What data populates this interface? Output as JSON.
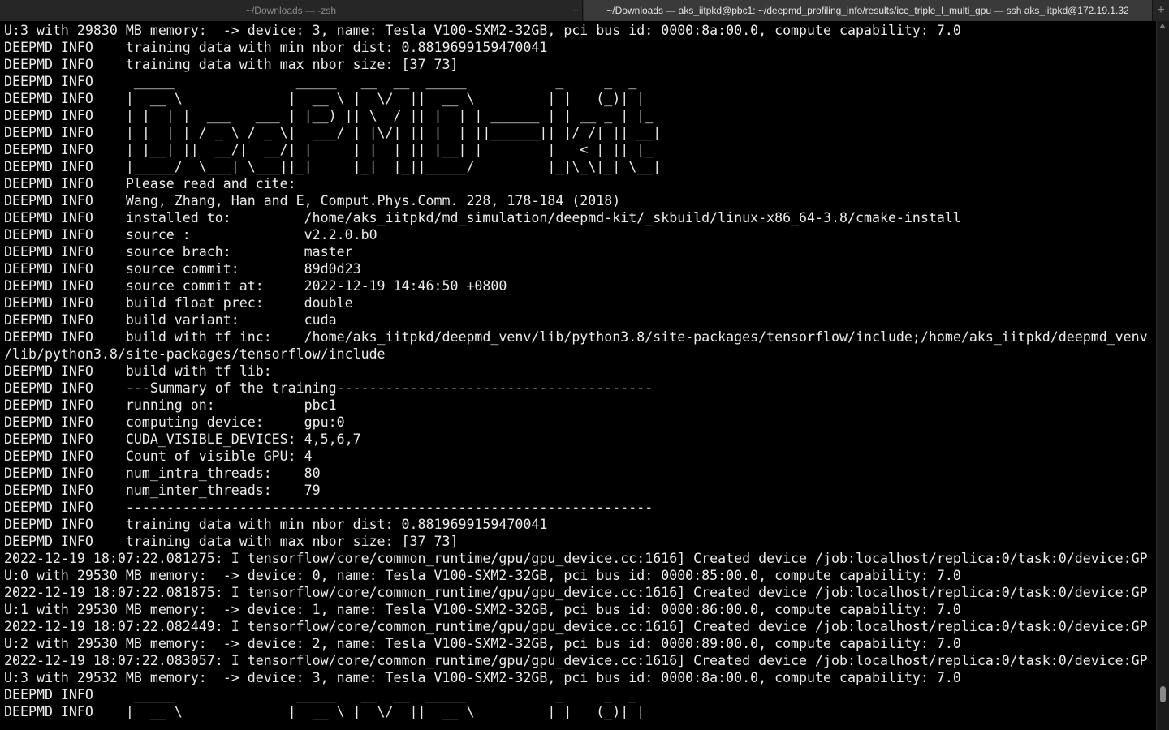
{
  "tabs": {
    "inactive_title": "~/Downloads — -zsh",
    "overflow_label": "...",
    "active_title": "~/Downloads — aks_iitpkd@pbc1: ~/deepmd_profiling_info/results/ice_triple_I_multi_gpu — ssh aks_iitpkd@172.19.1.32",
    "new_tab_label": "+"
  },
  "terminal": {
    "lines": [
      "U:3 with 29830 MB memory:  -> device: 3, name: Tesla V100-SXM2-32GB, pci bus id: 0000:8a:00.0, compute capability: 7.0",
      "DEEPMD INFO    training data with min nbor dist: 0.8819699159470041",
      "DEEPMD INFO    training data with max nbor size: [37 73]",
      "DEEPMD INFO     _____               _____   __  __  _____           _     _  _",
      "DEEPMD INFO    |  __ \\             |  __ \\ |  \\/  ||  __ \\         | |   (_)| |",
      "DEEPMD INFO    | |  | |  ___   ___ | |__) || \\  / || |  | | ______ | | __ _ | |_",
      "DEEPMD INFO    | |  | | / _ \\ / _ \\|  ___/ | |\\/| || |  | ||______|| |/ /| || __|",
      "DEEPMD INFO    | |__| ||  __/|  __/| |     | |  | || |__| |        |   < | || |_",
      "DEEPMD INFO    |_____/  \\___| \\___||_|     |_|  |_||_____/         |_|\\_\\|_| \\__|",
      "DEEPMD INFO    Please read and cite:",
      "DEEPMD INFO    Wang, Zhang, Han and E, Comput.Phys.Comm. 228, 178-184 (2018)",
      "DEEPMD INFO    installed to:         /home/aks_iitpkd/md_simulation/deepmd-kit/_skbuild/linux-x86_64-3.8/cmake-install",
      "DEEPMD INFO    source :              v2.2.0.b0",
      "DEEPMD INFO    source brach:         master",
      "DEEPMD INFO    source commit:        89d0d23",
      "DEEPMD INFO    source commit at:     2022-12-19 14:46:50 +0800",
      "DEEPMD INFO    build float prec:     double",
      "DEEPMD INFO    build variant:        cuda",
      "DEEPMD INFO    build with tf inc:    /home/aks_iitpkd/deepmd_venv/lib/python3.8/site-packages/tensorflow/include;/home/aks_iitpkd/deepmd_venv",
      "/lib/python3.8/site-packages/tensorflow/include",
      "DEEPMD INFO    build with tf lib:",
      "DEEPMD INFO    ---Summary of the training---------------------------------------",
      "DEEPMD INFO    running on:           pbc1",
      "DEEPMD INFO    computing device:     gpu:0",
      "DEEPMD INFO    CUDA_VISIBLE_DEVICES: 4,5,6,7",
      "DEEPMD INFO    Count of visible GPU: 4",
      "DEEPMD INFO    num_intra_threads:    80",
      "DEEPMD INFO    num_inter_threads:    79",
      "DEEPMD INFO    -----------------------------------------------------------------",
      "DEEPMD INFO    training data with min nbor dist: 0.8819699159470041",
      "DEEPMD INFO    training data with max nbor size: [37 73]",
      "2022-12-19 18:07:22.081275: I tensorflow/core/common_runtime/gpu/gpu_device.cc:1616] Created device /job:localhost/replica:0/task:0/device:GP",
      "U:0 with 29530 MB memory:  -> device: 0, name: Tesla V100-SXM2-32GB, pci bus id: 0000:85:00.0, compute capability: 7.0",
      "2022-12-19 18:07:22.081875: I tensorflow/core/common_runtime/gpu/gpu_device.cc:1616] Created device /job:localhost/replica:0/task:0/device:GP",
      "U:1 with 29530 MB memory:  -> device: 1, name: Tesla V100-SXM2-32GB, pci bus id: 0000:86:00.0, compute capability: 7.0",
      "2022-12-19 18:07:22.082449: I tensorflow/core/common_runtime/gpu/gpu_device.cc:1616] Created device /job:localhost/replica:0/task:0/device:GP",
      "U:2 with 29530 MB memory:  -> device: 2, name: Tesla V100-SXM2-32GB, pci bus id: 0000:89:00.0, compute capability: 7.0",
      "2022-12-19 18:07:22.083057: I tensorflow/core/common_runtime/gpu/gpu_device.cc:1616] Created device /job:localhost/replica:0/task:0/device:GP",
      "U:3 with 29532 MB memory:  -> device: 3, name: Tesla V100-SXM2-32GB, pci bus id: 0000:8a:00.0, compute capability: 7.0",
      "DEEPMD INFO     _____               _____   __  __  _____           _     _  _",
      "DEEPMD INFO    |  __ \\             |  __ \\ |  \\/  ||  __ \\         | |   (_)| |"
    ]
  }
}
